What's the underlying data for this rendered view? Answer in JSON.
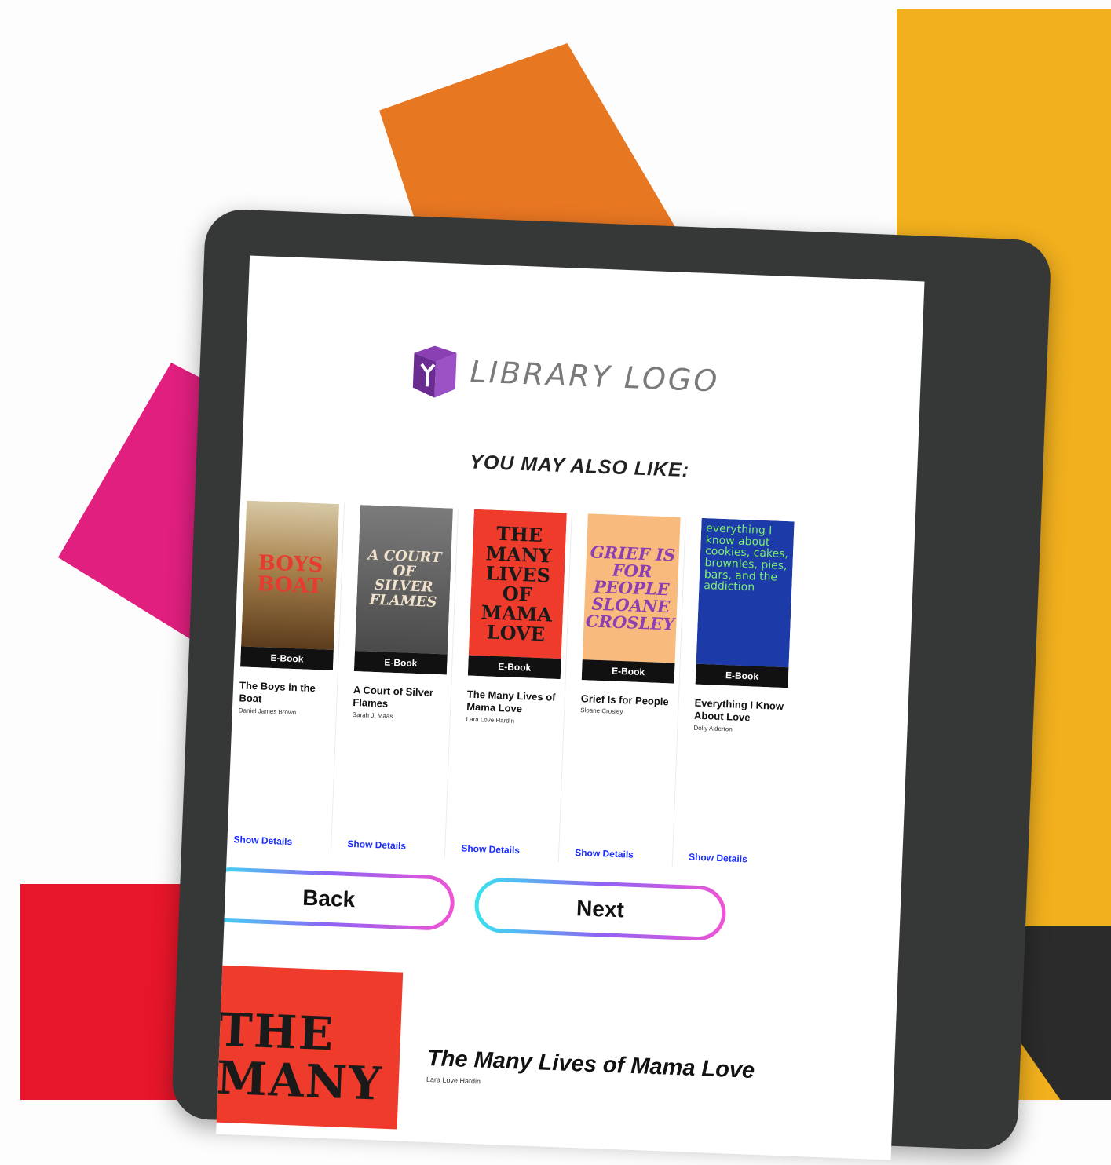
{
  "logo": {
    "text": "LIBRARY LOGO",
    "color": "#6a2c91"
  },
  "section_title": "YOU MAY ALSO LIKE:",
  "books": [
    {
      "cover_text": "BOYS BOAT",
      "format": "E-Book",
      "title": "The Boys in the Boat",
      "author": "Daniel James Brown",
      "details": "Show Details"
    },
    {
      "cover_text": "A COURT OF SILVER FLAMES",
      "format": "E-Book",
      "title": "A Court of Silver Flames",
      "author": "Sarah J. Maas",
      "details": "Show Details"
    },
    {
      "cover_text": "THE MANY LIVES OF MAMA LOVE",
      "format": "E-Book",
      "title": "The Many Lives of Mama Love",
      "author": "Lara Love Hardin",
      "details": "Show Details"
    },
    {
      "cover_text": "GRIEF IS FOR PEOPLE SLOANE CROSLEY",
      "format": "E-Book",
      "title": "Grief Is for People",
      "author": "Sloane Crosley",
      "details": "Show Details"
    },
    {
      "cover_text": "everything I know about cookies, cakes, brownies, pies, bars, and the addiction",
      "format": "E-Book",
      "title": "Everything I Know About Love",
      "author": "Dolly Alderton",
      "details": "Show Details"
    }
  ],
  "buttons": {
    "back": "Back",
    "next": "Next"
  },
  "detail": {
    "cover_text": "THE MANY",
    "title": "The Many Lives of Mama Love",
    "author": "Lara Love Hardin"
  },
  "colors": {
    "yellow": "#f2b01e",
    "orange": "#e87722",
    "pink": "#e01f7f",
    "red": "#e8162a",
    "tablet": "#363838"
  }
}
